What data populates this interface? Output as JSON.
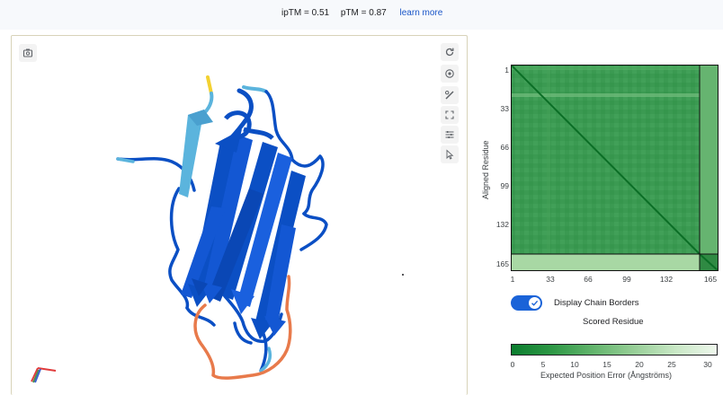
{
  "header": {
    "iptm": "ipTM = 0.51",
    "ptm": "pTM = 0.87",
    "learn_more": "learn more"
  },
  "viewer": {
    "icons": [
      "screenshot-icon",
      "rotate-icon",
      "center-icon",
      "measure-icon",
      "fullscreen-icon",
      "settings-sliders-icon",
      "cursor-icon"
    ],
    "chain_colors": {
      "high": "#0b4fc4",
      "mid": "#5bb4dd",
      "low": "#e87a4b",
      "very_low": "#f3d131"
    }
  },
  "pae": {
    "y_axis_label": "Aligned Residue",
    "y_ticks": [
      "1",
      "33",
      "66",
      "99",
      "132",
      "165"
    ],
    "x_ticks": [
      "1",
      "33",
      "66",
      "99",
      "132",
      "165"
    ],
    "toggle_label": "Display Chain Borders",
    "toggle_on": true,
    "x_axis_label": "Scored Residue",
    "colorbar_ticks": [
      "0",
      "5",
      "10",
      "15",
      "20",
      "25",
      "30"
    ],
    "colorbar_label": "Expected Position Error (Ångströms)",
    "colors": {
      "low_error": "#0b7d2e",
      "high_error": "#eef8ec",
      "accent": "#1a63d8"
    }
  }
}
